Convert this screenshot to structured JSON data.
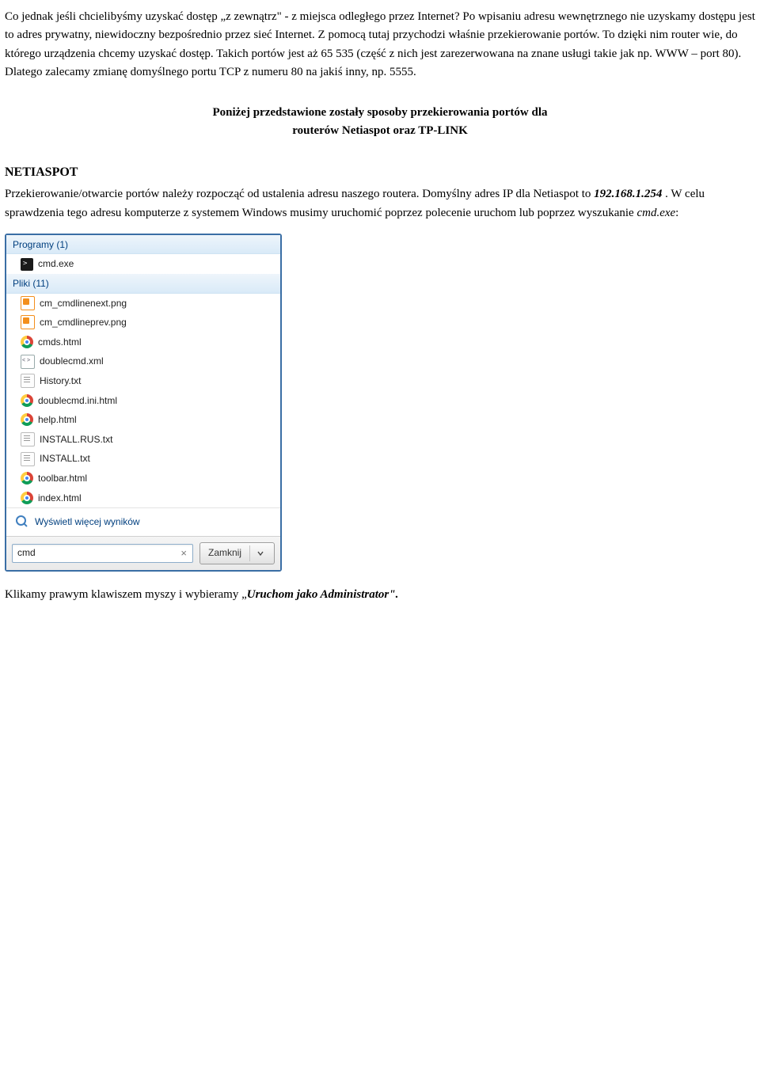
{
  "doc": {
    "para1": "Co jednak jeśli chcielibyśmy uzyskać dostęp „z zewnątrz\" - z miejsca odległego przez Internet? Po wpisaniu adresu wewnętrznego nie uzyskamy dostępu jest to adres prywatny, niewidoczny bezpośrednio przez sieć Internet. Z pomocą tutaj przychodzi właśnie przekierowanie portów. To dzięki nim router wie, do którego urządzenia chcemy uzyskać dostęp. Takich portów jest aż 65 535 (część z nich jest zarezerwowana na znane usługi takie jak np. WWW – port 80). Dlatego zalecamy zmianę domyślnego portu TCP z numeru 80 na jakiś inny, np. 5555.",
    "centered_line1": "Poniżej przedstawione zostały sposoby przekierowania portów dla",
    "centered_line2": "routerów Netiaspot oraz TP-LINK",
    "section_heading": "NETIASPOT",
    "para2_a": "Przekierowanie/otwarcie portów należy rozpocząć od ustalenia adresu naszego routera. Domyślny adres IP dla Netiaspot to ",
    "ip": "192.168.1.254",
    "para2_b": " . W celu sprawdzenia tego adresu komputerze z systemem Windows musimy uruchomić poprzez polecenie uruchom lub poprzez wyszukanie ",
    "cmd_file": "cmd.exe",
    "colon": ":",
    "last_line_a": "Klikamy prawym klawiszem myszy i wybieramy „",
    "last_line_b": "Uruchom jako Administrator\"."
  },
  "panel": {
    "groups": {
      "programs": "Programy (1)",
      "files": "Pliki (11)"
    },
    "programs_list": [
      {
        "icon": "cmd",
        "label": "cmd.exe"
      }
    ],
    "files_list": [
      {
        "icon": "png",
        "label": "cm_cmdlinenext.png"
      },
      {
        "icon": "png",
        "label": "cm_cmdlineprev.png"
      },
      {
        "icon": "chrome",
        "label": "cmds.html"
      },
      {
        "icon": "xml",
        "label": "doublecmd.xml"
      },
      {
        "icon": "txt",
        "label": "History.txt"
      },
      {
        "icon": "chrome",
        "label": "doublecmd.ini.html"
      },
      {
        "icon": "chrome",
        "label": "help.html"
      },
      {
        "icon": "txt",
        "label": "INSTALL.RUS.txt"
      },
      {
        "icon": "txt",
        "label": "INSTALL.txt"
      },
      {
        "icon": "chrome",
        "label": "toolbar.html"
      },
      {
        "icon": "chrome",
        "label": "index.html"
      }
    ],
    "more_results": "Wyświetl więcej wyników",
    "search_value": "cmd",
    "shutdown_label": "Zamknij"
  }
}
